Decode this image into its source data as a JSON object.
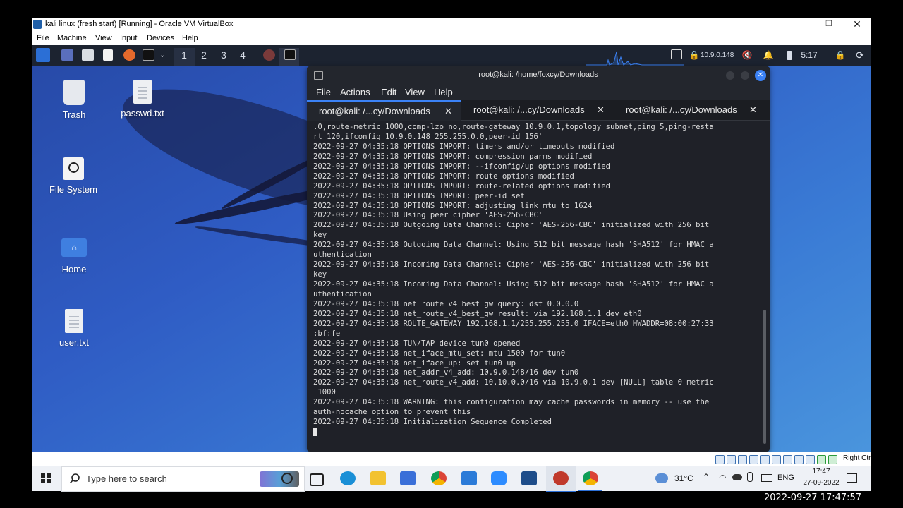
{
  "vbox": {
    "title": "kali linux (fresh start) [Running] - Oracle VM VirtualBox",
    "minimize": "—",
    "maximize": "❐",
    "close": "✕",
    "menu": [
      "File",
      "Machine",
      "View",
      "Input",
      "Devices",
      "Help"
    ],
    "host_key": "Right Ctrl"
  },
  "kali_panel": {
    "workspaces": [
      "1",
      "2",
      "3",
      "4"
    ],
    "ip": "10.9.0.148",
    "battery": "5:17"
  },
  "desktop": {
    "icons": [
      {
        "label": "Trash",
        "icon": "trash-icon"
      },
      {
        "label": "passwd.txt",
        "icon": "text-file-icon"
      },
      {
        "label": "File System",
        "icon": "drive-icon"
      },
      {
        "label": "Home",
        "icon": "home-folder-icon"
      },
      {
        "label": "user.txt",
        "icon": "text-file-icon"
      }
    ]
  },
  "terminal": {
    "title": "root@kali: /home/foxcy/Downloads",
    "menu": [
      "File",
      "Actions",
      "Edit",
      "View",
      "Help"
    ],
    "tabs": [
      {
        "label": "root@kali: /...cy/Downloads",
        "active": true
      },
      {
        "label": "root@kali: /...cy/Downloads",
        "active": false
      },
      {
        "label": "root@kali: /...cy/Downloads",
        "active": false
      }
    ],
    "lines": [
      ".0,route-metric 1000,comp-lzo no,route-gateway 10.9.0.1,topology subnet,ping 5,ping-resta",
      "rt 120,ifconfig 10.9.0.148 255.255.0.0,peer-id 156'",
      "2022-09-27 04:35:18 OPTIONS IMPORT: timers and/or timeouts modified",
      "2022-09-27 04:35:18 OPTIONS IMPORT: compression parms modified",
      "2022-09-27 04:35:18 OPTIONS IMPORT: --ifconfig/up options modified",
      "2022-09-27 04:35:18 OPTIONS IMPORT: route options modified",
      "2022-09-27 04:35:18 OPTIONS IMPORT: route-related options modified",
      "2022-09-27 04:35:18 OPTIONS IMPORT: peer-id set",
      "2022-09-27 04:35:18 OPTIONS IMPORT: adjusting link_mtu to 1624",
      "2022-09-27 04:35:18 Using peer cipher 'AES-256-CBC'",
      "2022-09-27 04:35:18 Outgoing Data Channel: Cipher 'AES-256-CBC' initialized with 256 bit",
      "key",
      "2022-09-27 04:35:18 Outgoing Data Channel: Using 512 bit message hash 'SHA512' for HMAC a",
      "uthentication",
      "2022-09-27 04:35:18 Incoming Data Channel: Cipher 'AES-256-CBC' initialized with 256 bit",
      "key",
      "2022-09-27 04:35:18 Incoming Data Channel: Using 512 bit message hash 'SHA512' for HMAC a",
      "uthentication",
      "2022-09-27 04:35:18 net_route_v4_best_gw query: dst 0.0.0.0",
      "2022-09-27 04:35:18 net_route_v4_best_gw result: via 192.168.1.1 dev eth0",
      "2022-09-27 04:35:18 ROUTE_GATEWAY 192.168.1.1/255.255.255.0 IFACE=eth0 HWADDR=08:00:27:33",
      ":bf:fe",
      "2022-09-27 04:35:18 TUN/TAP device tun0 opened",
      "2022-09-27 04:35:18 net_iface_mtu_set: mtu 1500 for tun0",
      "2022-09-27 04:35:18 net_iface_up: set tun0 up",
      "2022-09-27 04:35:18 net_addr_v4_add: 10.9.0.148/16 dev tun0",
      "2022-09-27 04:35:18 net_route_v4_add: 10.10.0.0/16 via 10.9.0.1 dev [NULL] table 0 metric",
      " 1000",
      "2022-09-27 04:35:18 WARNING: this configuration may cache passwords in memory -- use the",
      "auth-nocache option to prevent this",
      "2022-09-27 04:35:18 Initialization Sequence Completed"
    ]
  },
  "taskbar": {
    "search_placeholder": "Type here to search",
    "temperature": "31°C",
    "language": "ENG",
    "time": "17:47",
    "date": "27-09-2022"
  },
  "caption": "2022-09-27  17:47:57"
}
